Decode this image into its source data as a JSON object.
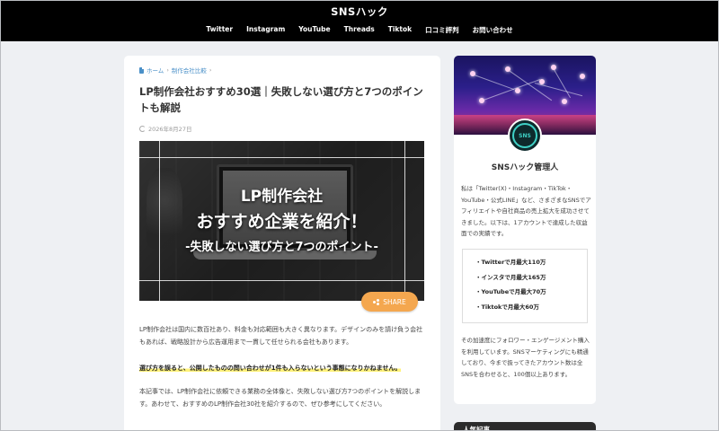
{
  "site": {
    "title": "SNSハック",
    "nav": [
      "Twitter",
      "Instagram",
      "YouTube",
      "Threads",
      "Tiktok",
      "口コミ評判",
      "お問い合わせ"
    ]
  },
  "article": {
    "breadcrumb": [
      "ホーム",
      "制作会社比較"
    ],
    "title": "LP制作会社おすすめ30選｜失敗しない選び方と7つのポイントも解説",
    "date": "2026年8月27日",
    "eyecatch": {
      "line1": "LP制作会社",
      "line2": "おすすめ企業を紹介！",
      "line3": "-失敗しない選び方と7つのポイント-"
    },
    "share_label": "SHARE",
    "paragraph1": "LP制作会社は国内に数百社あり、料金も対応範囲も大きく異なります。デザインのみを請け負う会社もあれば、戦略設計から広告運用まで一貫して任せられる会社もあります。",
    "highlight": "選び方を誤ると、公開したものの問い合わせが1件も入らないという事態になりかねません。",
    "paragraph2": "本記事では、LP制作会社に依頼できる業務の全体像と、失敗しない選び方7つのポイントを解説します。あわせて、おすすめのLP制作会社30社を紹介するので、ぜひ参考にしてください。"
  },
  "sidebar": {
    "avatar_text": "SNS",
    "author_name": "SNSハック管理人",
    "bio1": "私は「Twitter(X)・Instagram・TikTok・YouTube・公式LINE」など、さまざまなSNSでアフィリエイトや自社商品の売上拡大を成功させてきました。以下は、1アカウントで達成した収益面での実績です。",
    "achievements": [
      "・Twitterで月最大110万",
      "・インスタで月最大165万",
      "・YouTubeで月最大70万",
      "・Tiktokで月最大60万"
    ],
    "bio2": "その加速度にフォロワー・エンゲージメント購入を利用しています。SNSマーケティングにも精通しており、今まで扱ってきたアカウント数は全SNSを合わせると、100個以上あります。",
    "widget2_title": "人気記事"
  },
  "colors": {
    "header_bg": "#000000",
    "link": "#4a90c8",
    "share": "#f4a74f",
    "highlight": "#fff27a"
  }
}
